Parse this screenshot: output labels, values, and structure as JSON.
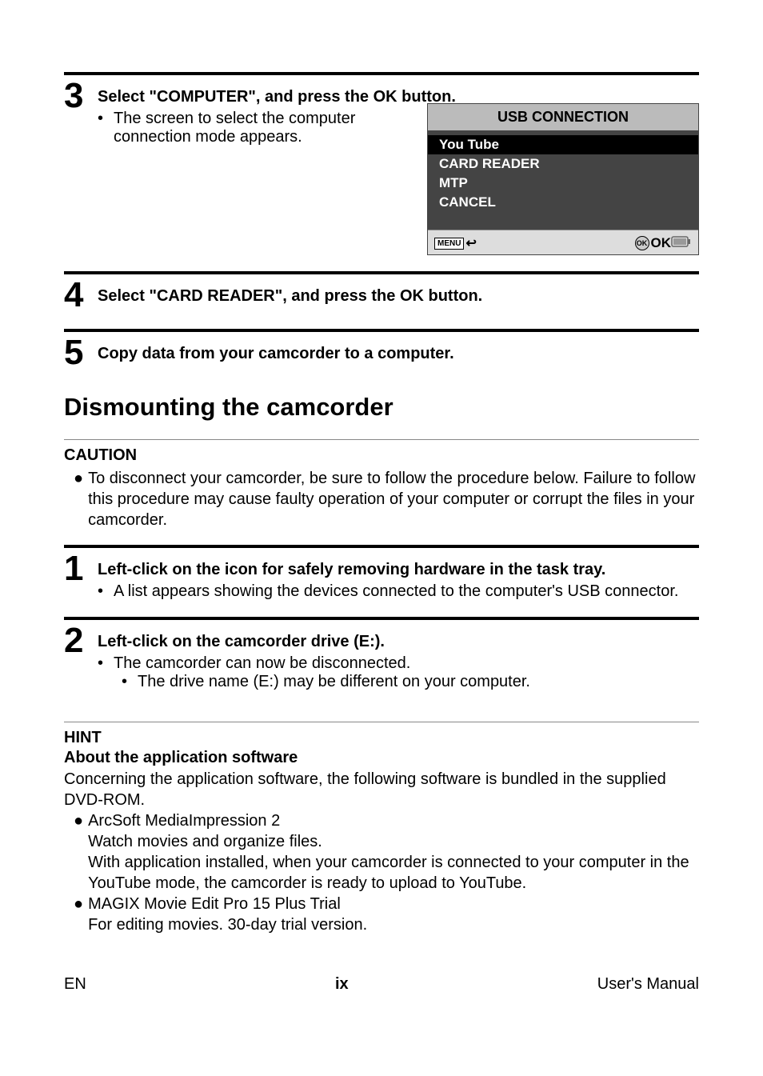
{
  "steps": {
    "s3": {
      "num": "3",
      "title": "Select \"COMPUTER\", and press the OK button.",
      "sub": "The screen to select the computer connection mode appears."
    },
    "s4": {
      "num": "4",
      "title": "Select \"CARD READER\", and press the OK button."
    },
    "s5": {
      "num": "5",
      "title": "Copy data from your camcorder to a computer."
    },
    "s1b": {
      "num": "1",
      "title": "Left-click on the icon for safely removing hardware in the task tray.",
      "sub": "A list appears showing the devices connected to the computer's USB connector."
    },
    "s2b": {
      "num": "2",
      "title": "Left-click on the camcorder drive (E:).",
      "sub1": "The camcorder can now be disconnected.",
      "sub2": "The drive name (E:) may be different on your computer."
    }
  },
  "usb": {
    "title": "USB CONNECTION",
    "opt1": "You Tube",
    "opt2": "CARD READER",
    "opt3": "MTP",
    "opt4": "CANCEL",
    "menu": "MENU",
    "ok": "OK",
    "okCircle": "OK"
  },
  "heading": "Dismounting the camcorder",
  "caution": {
    "title": "CAUTION",
    "body": "To disconnect your camcorder, be sure to follow the procedure below. Failure to follow this procedure may cause faulty operation of your computer or corrupt the files in your camcorder."
  },
  "hint": {
    "title": "HINT",
    "about": "About the application software",
    "intro": "Concerning the application software, the following software is bundled in the supplied DVD-ROM.",
    "b1_title": "ArcSoft MediaImpression 2",
    "b1_line1": "Watch movies and organize files.",
    "b1_line2": "With application installed, when your camcorder is connected to your computer in the YouTube mode, the camcorder is ready to upload to YouTube.",
    "b2_title": "MAGIX Movie Edit Pro 15 Plus Trial",
    "b2_line1": "For editing movies. 30-day trial version."
  },
  "footer": {
    "left": "EN",
    "center": "ix",
    "right": "User's Manual"
  }
}
